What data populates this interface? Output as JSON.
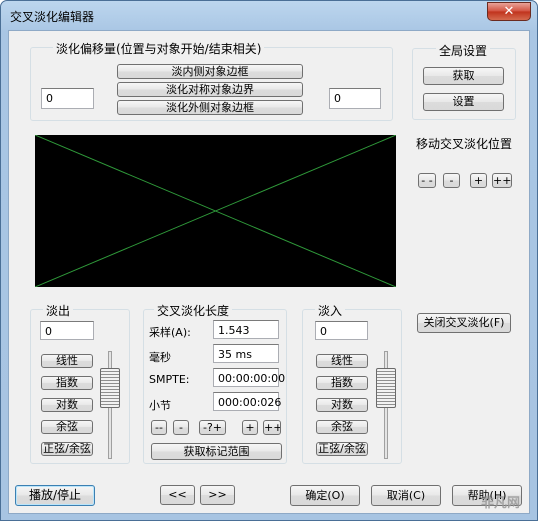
{
  "window": {
    "title": "交叉淡化编辑器",
    "close_glyph": "✕"
  },
  "offset_group": {
    "label": "淡化偏移量(位置与对象开始/结束相关)",
    "buttons": [
      "淡内侧对象边框",
      "淡化对称对象边界",
      "淡化外侧对象边框"
    ],
    "left_value": "0",
    "right_value": "0"
  },
  "global_group": {
    "label": "全局设置",
    "get_label": "获取",
    "set_label": "设置"
  },
  "move_crossfade": {
    "label": "移动交叉淡化位置",
    "buttons": [
      "- -",
      "-",
      "+",
      "++"
    ]
  },
  "close_crossfade_label": "关闭交叉淡化(F)",
  "fade_out": {
    "label": "淡出",
    "value": "0",
    "curve_buttons": [
      "线性",
      "指数",
      "对数",
      "余弦",
      "正弦/余弦"
    ]
  },
  "crossfade_length": {
    "label": "交叉淡化长度",
    "rows": [
      {
        "label": "采样(A):",
        "value": "1.543"
      },
      {
        "label": "毫秒",
        "value": "35 ms"
      },
      {
        "label": "SMPTE:",
        "value": "00:00:00:00"
      },
      {
        "label": "小节",
        "value": "000:00:026"
      }
    ],
    "nudge_buttons": [
      "--",
      "-",
      "-?+",
      "+",
      "++"
    ],
    "get_range_label": "获取标记范围"
  },
  "fade_in": {
    "label": "淡入",
    "value": "0",
    "curve_buttons": [
      "线性",
      "指数",
      "对数",
      "余弦",
      "正弦/余弦"
    ]
  },
  "footer": {
    "play_stop_label": "播放/停止",
    "prev_label": "<<",
    "next_label": ">>",
    "ok_label": "确定(O)",
    "cancel_label": "取消(C)",
    "help_label": "帮助(H)"
  },
  "watermark": "非凡网",
  "colors": {
    "preview_bg": "#000000",
    "fade_line": "#2f9a3a",
    "accent_border": "#3c7fb1"
  }
}
